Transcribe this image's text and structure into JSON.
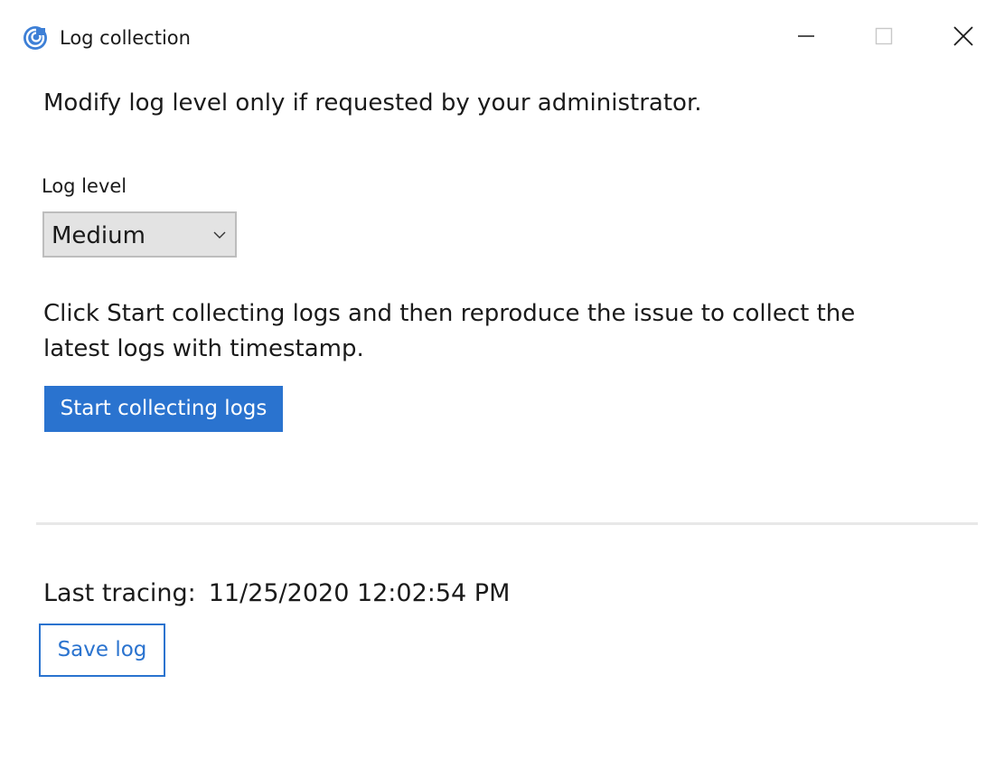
{
  "window": {
    "title": "Log collection",
    "app_icon": "citrix-app-icon",
    "controls": {
      "minimize_icon": "minimize-icon",
      "maximize_icon": "maximize-icon",
      "close_icon": "close-icon"
    }
  },
  "main": {
    "instruction": "Modify log level only if requested by your administrator.",
    "log_level": {
      "label": "Log level",
      "selected": "Medium",
      "chevron_icon": "chevron-down-icon"
    },
    "paragraph": "Click Start collecting logs and then reproduce the issue to collect the latest logs with timestamp.",
    "start_button_label": "Start collecting logs"
  },
  "footer": {
    "last_tracing_label": "Last tracing:",
    "last_tracing_value": "11/25/2020 12:02:54 PM",
    "save_button_label": "Save log"
  },
  "colors": {
    "accent": "#2a73cf",
    "dropdown_bg": "#e3e3e3",
    "divider": "#e8e8e8"
  }
}
